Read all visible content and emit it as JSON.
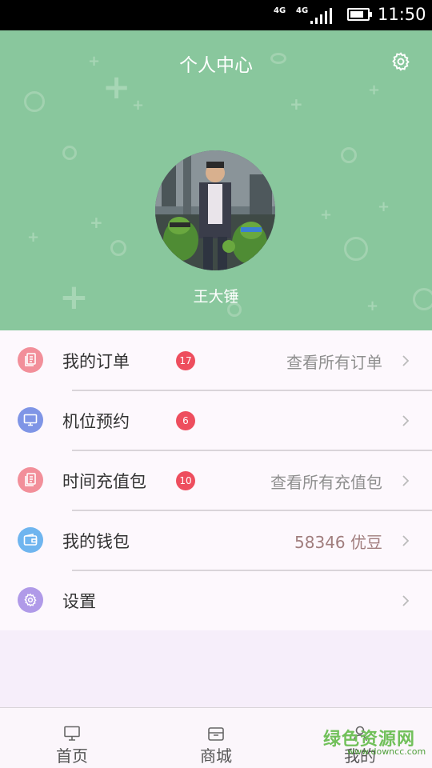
{
  "status_bar": {
    "network_1": "4G",
    "network_2": "4G",
    "time": "11:50"
  },
  "header": {
    "title": "个人中心",
    "username": "王大锤",
    "settings_icon": "gear-icon",
    "background_color": "#89c79d"
  },
  "menu": {
    "items": [
      {
        "label": "我的订单",
        "badge": "17",
        "right_text": "查看所有订单",
        "icon": "document-icon",
        "icon_color": "#f28f9a"
      },
      {
        "label": "机位预约",
        "badge": "6",
        "right_text": "",
        "icon": "monitor-icon",
        "icon_color": "#7f95e6"
      },
      {
        "label": "时间充值包",
        "badge": "10",
        "right_text": "查看所有充值包",
        "icon": "document-icon",
        "icon_color": "#f28f9a"
      },
      {
        "label": "我的钱包",
        "badge": "",
        "right_text": "58346 优豆",
        "icon": "wallet-icon",
        "icon_color": "#6fb5ef"
      },
      {
        "label": "设置",
        "badge": "",
        "right_text": "",
        "icon": "gear-icon",
        "icon_color": "#b09ae8"
      }
    ]
  },
  "tabbar": {
    "tabs": [
      {
        "label": "首页",
        "icon": "monitor-icon"
      },
      {
        "label": "商城",
        "icon": "store-icon"
      },
      {
        "label": "我的",
        "icon": "user-icon"
      }
    ]
  },
  "watermark": {
    "text": "绿色资源网",
    "url": "www.downcc.com"
  },
  "badge_color": "#ee4e5e"
}
